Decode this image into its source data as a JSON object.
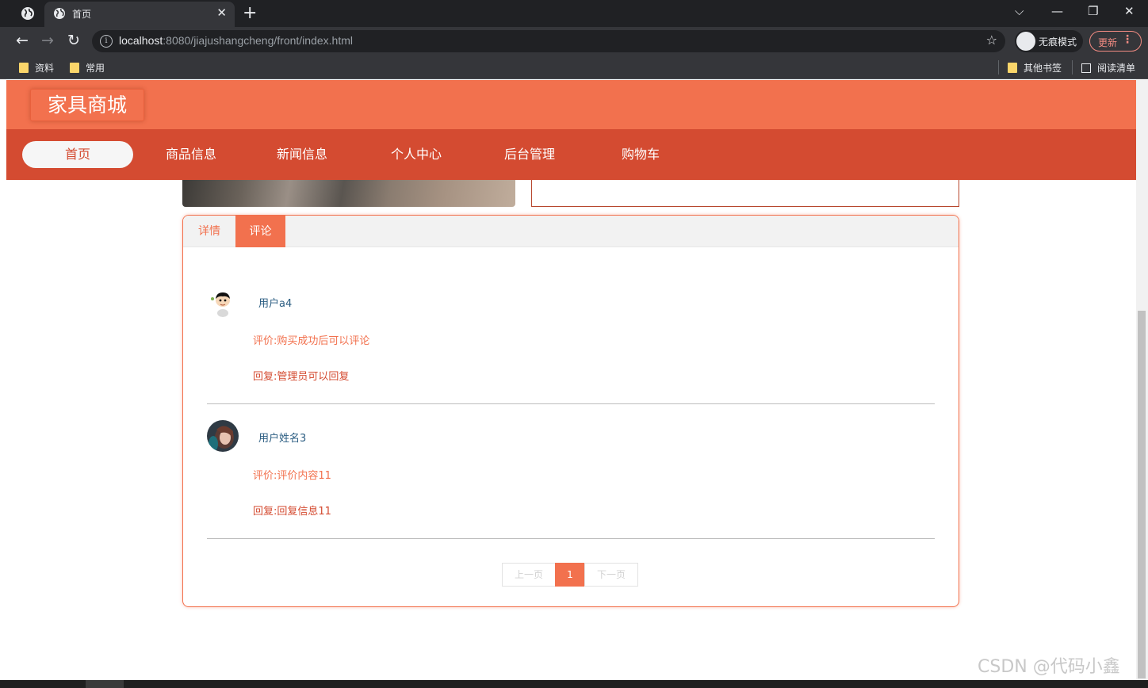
{
  "browser": {
    "tab_title": "首页",
    "url_host": "localhost",
    "url_rest": ":8080/jiajushangcheng/front/index.html",
    "incognito_label": "无痕模式",
    "update_label": "更新",
    "bookmarks": [
      "资料",
      "常用"
    ],
    "other_bookmarks": "其他书签",
    "reading_list": "阅读清单"
  },
  "site": {
    "logo_text": "家具商城",
    "nav": [
      "首页",
      "商品信息",
      "新闻信息",
      "个人中心",
      "后台管理",
      "购物车"
    ],
    "active_nav": "首页"
  },
  "product_tabs": {
    "tabs": [
      "详情",
      "评论"
    ],
    "active": "评论"
  },
  "comments": [
    {
      "user": "用户a4",
      "content": "评价:购买成功后可以评论",
      "reply": "回复:管理员可以回复"
    },
    {
      "user": "用户姓名3",
      "content": "评价:评价内容11",
      "reply": "回复:回复信息11"
    }
  ],
  "pagination": {
    "prev": "上一页",
    "current": "1",
    "next": "下一页"
  },
  "watermark": "CSDN @代码小鑫",
  "colors": {
    "header": "#f2714e",
    "nav": "#d44b31",
    "accent": "#f2714e"
  }
}
